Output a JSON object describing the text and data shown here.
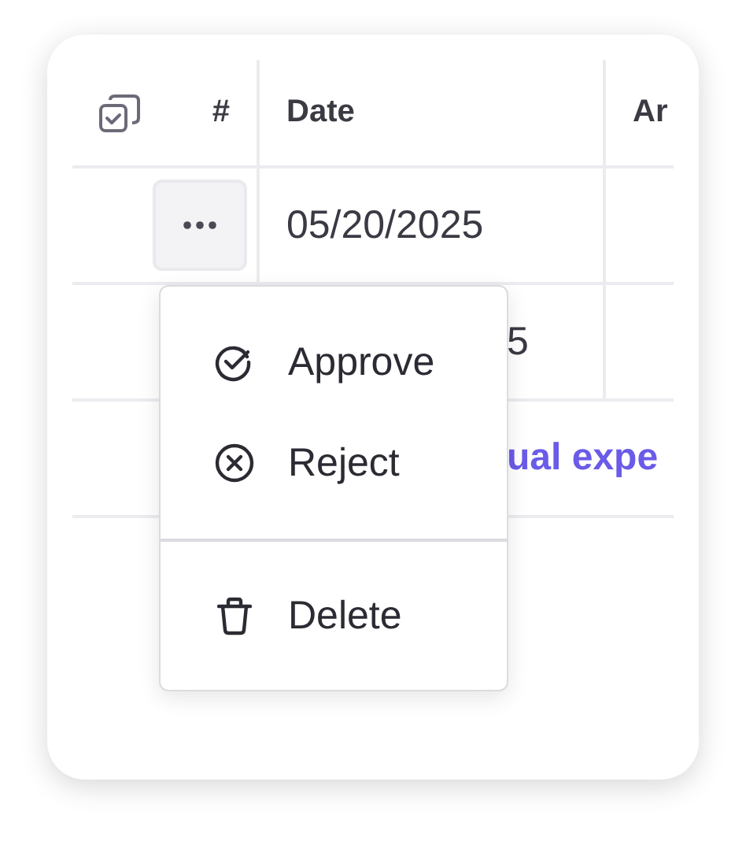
{
  "table": {
    "columns": [
      {
        "kind": "select",
        "label": "#"
      },
      {
        "kind": "text",
        "label": "Date"
      },
      {
        "kind": "text",
        "label": "Ar"
      }
    ],
    "rows": [
      {
        "date": "05/20/2025",
        "actions": true
      },
      {
        "date": "5",
        "actions": false
      }
    ],
    "footer_link": "ual expe"
  },
  "menu": {
    "sections": [
      [
        {
          "kind": "approve",
          "label": "Approve"
        },
        {
          "kind": "reject",
          "label": "Reject"
        }
      ],
      [
        {
          "kind": "delete",
          "label": "Delete"
        }
      ]
    ]
  }
}
